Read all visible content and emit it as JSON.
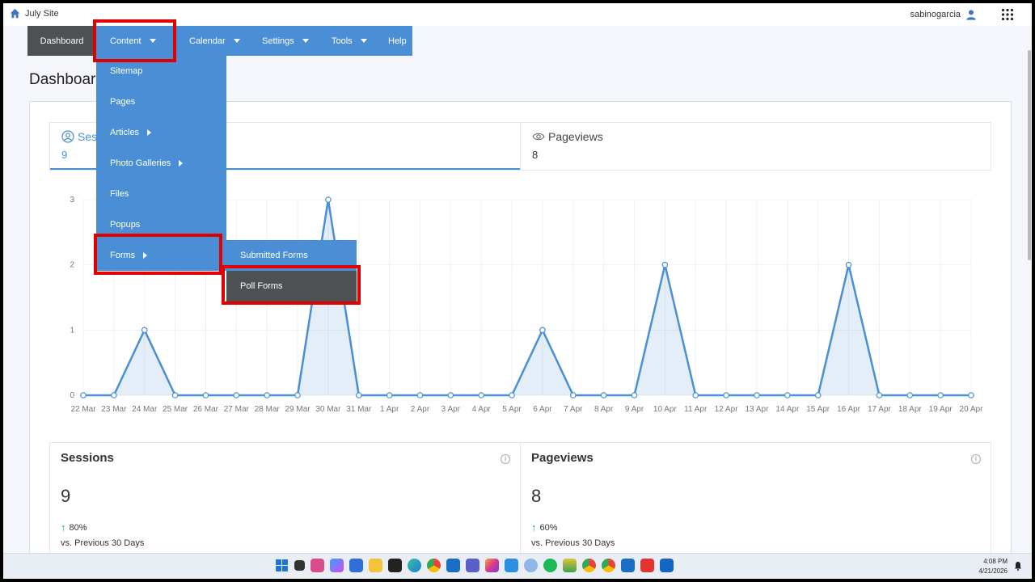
{
  "site": {
    "title": "July Site"
  },
  "user": {
    "name": "sabinogarcia"
  },
  "nav": {
    "items": [
      {
        "label": "Dashboard",
        "has_caret": false
      },
      {
        "label": "Content",
        "has_caret": true
      },
      {
        "label": "Calendar",
        "has_caret": true
      },
      {
        "label": "Settings",
        "has_caret": true
      },
      {
        "label": "Tools",
        "has_caret": true
      },
      {
        "label": "Help",
        "has_caret": false
      }
    ]
  },
  "page": {
    "title": "Dashboard"
  },
  "content_menu": {
    "items": [
      {
        "label": "Sitemap"
      },
      {
        "label": "Pages"
      },
      {
        "label": "Articles"
      },
      {
        "label": "Photo Galleries"
      },
      {
        "label": "Files"
      },
      {
        "label": "Popups"
      },
      {
        "label": "Forms"
      }
    ]
  },
  "forms_submenu": {
    "items": [
      {
        "label": "Submitted Forms"
      },
      {
        "label": "Poll Forms"
      }
    ]
  },
  "tabs": [
    {
      "label": "Sessions",
      "value": "9"
    },
    {
      "label": "Pageviews",
      "value": "8"
    }
  ],
  "chart_data": {
    "type": "area",
    "categories": [
      "22 Mar",
      "23 Mar",
      "24 Mar",
      "25 Mar",
      "26 Mar",
      "27 Mar",
      "28 Mar",
      "29 Mar",
      "30 Mar",
      "31 Mar",
      "1 Apr",
      "2 Apr",
      "3 Apr",
      "4 Apr",
      "5 Apr",
      "6 Apr",
      "7 Apr",
      "8 Apr",
      "9 Apr",
      "10 Apr",
      "11 Apr",
      "12 Apr",
      "13 Apr",
      "14 Apr",
      "15 Apr",
      "16 Apr",
      "17 Apr",
      "18 Apr",
      "19 Apr",
      "20 Apr"
    ],
    "values": [
      0,
      0,
      1,
      0,
      0,
      0,
      0,
      0,
      3,
      0,
      0,
      0,
      0,
      0,
      0,
      1,
      0,
      0,
      0,
      2,
      0,
      0,
      0,
      0,
      0,
      2,
      0,
      0,
      0,
      0
    ],
    "yticks": [
      0,
      1,
      2,
      3
    ],
    "ylim": [
      0,
      3
    ],
    "color": "#4a8fd6",
    "grid": true
  },
  "stats": [
    {
      "title": "Sessions",
      "value": "9",
      "change": "80%",
      "compare": "vs. Previous 30 Days"
    },
    {
      "title": "Pageviews",
      "value": "8",
      "change": "60%",
      "compare": "vs. Previous 30 Days"
    }
  ],
  "taskbar": {
    "time": "4:08 PM",
    "date": "4/21/2026"
  }
}
